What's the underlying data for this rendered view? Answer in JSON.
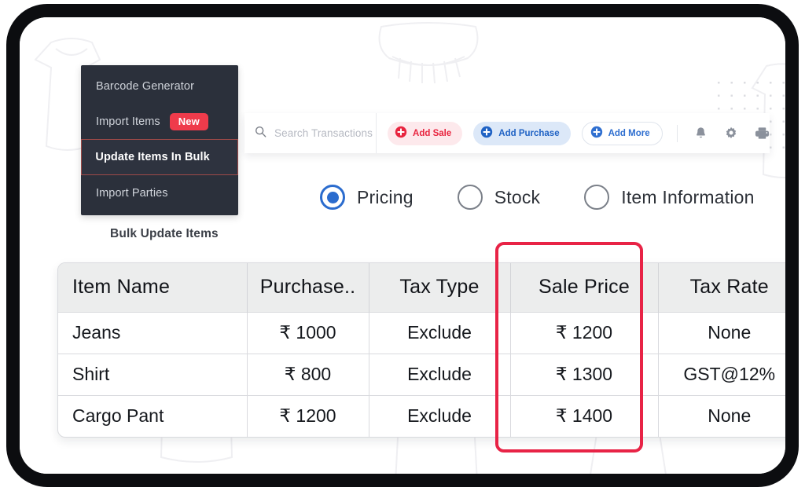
{
  "sidebar": {
    "items": [
      {
        "label": "Barcode Generator",
        "badge": null,
        "active": false
      },
      {
        "label": "Import Items",
        "badge": "New",
        "active": false
      },
      {
        "label": "Update Items In Bulk",
        "badge": null,
        "active": true
      },
      {
        "label": "Import Parties",
        "badge": null,
        "active": false
      }
    ]
  },
  "toolbar": {
    "search_placeholder": "Search Transactions",
    "add_sale_label": "Add Sale",
    "add_purchase_label": "Add Purchase",
    "add_more_label": "Add More",
    "icons": [
      "search-icon",
      "plus-circle-icon",
      "bell-icon",
      "gear-icon",
      "printer-icon"
    ],
    "colors": {
      "sale_text": "#e8243f",
      "sale_bg": "#fde9ec",
      "purchase_text": "#1f62c4",
      "purchase_bg": "#dce8f8",
      "more_text": "#2f6fd0"
    }
  },
  "view_modes": {
    "options": [
      {
        "label": "Pricing",
        "selected": true
      },
      {
        "label": "Stock",
        "selected": false
      },
      {
        "label": "Item Information",
        "selected": false
      }
    ],
    "accent_color": "#2b6cce"
  },
  "section": {
    "caption": "Bulk Update Items"
  },
  "table": {
    "columns": [
      "Item Name",
      "Purchase..",
      "Tax Type",
      "Sale Price",
      "Tax Rate"
    ],
    "rows": [
      {
        "item": "Jeans",
        "purchase": "₹ 1000",
        "tax_type": "Exclude",
        "sale_price": "₹ 1200",
        "tax_rate": "None"
      },
      {
        "item": "Shirt",
        "purchase": "₹ 800",
        "tax_type": "Exclude",
        "sale_price": "₹ 1300",
        "tax_rate": "GST@12%"
      },
      {
        "item": "Cargo Pant",
        "purchase": "₹ 1200",
        "tax_type": "Exclude",
        "sale_price": "₹ 1400",
        "tax_rate": "None"
      }
    ],
    "highlighted_column": "Sale Price",
    "highlight_color": "#e82346"
  }
}
